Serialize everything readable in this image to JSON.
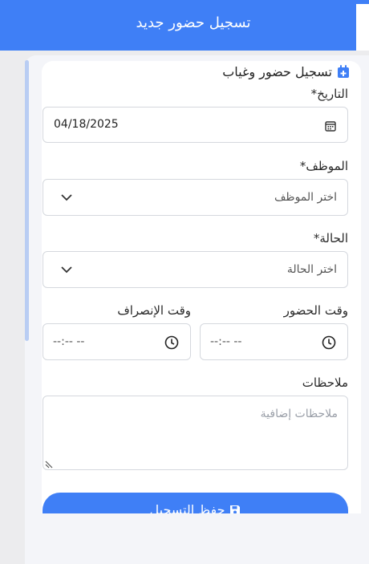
{
  "header": {
    "title": "تسجيل حضور جديد"
  },
  "form": {
    "title": "تسجيل حضور وغياب",
    "date_label": "التاريخ*",
    "date_value": "04/18/2025",
    "employee_label": "الموظف*",
    "employee_placeholder": "اختر الموظف",
    "status_label": "الحالة*",
    "status_placeholder": "اختر الحالة",
    "checkin_label": "وقت الحضور",
    "checkin_value": "--:-- --",
    "checkout_label": "وقت الإنصراف",
    "checkout_value": "--:-- --",
    "notes_label": "ملاحظات",
    "notes_placeholder": "ملاحظات إضافية",
    "save_label": "حفظ التسجيل"
  },
  "icons": {
    "title": "calendar-plus-icon",
    "date": "calendar-icon",
    "time": "clock-icon",
    "select": "chevron-down-icon",
    "save": "floppy-disk-icon",
    "resize": "resize-handle-icon"
  },
  "colors": {
    "primary": "#3f7ff6",
    "panel": "#f4f5f9",
    "border": "#d5d8de"
  }
}
